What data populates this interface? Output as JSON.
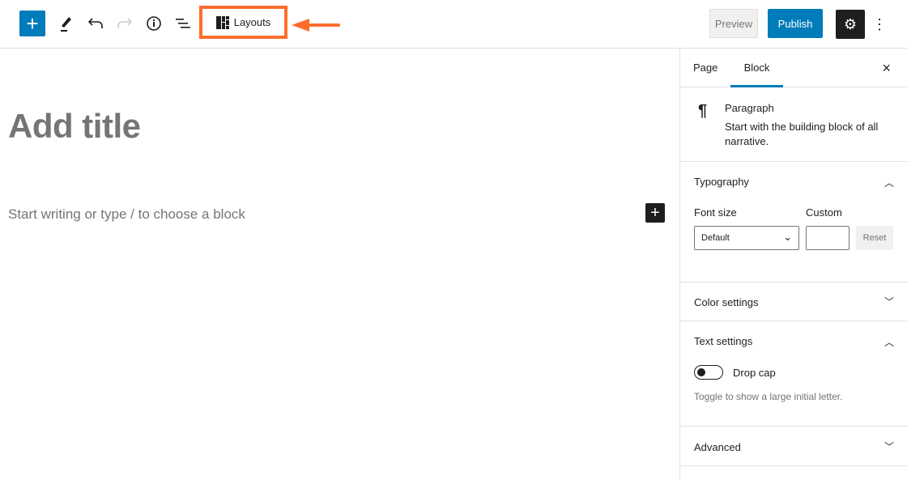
{
  "toolbar": {
    "add_label": "+",
    "layouts_label": "Layouts",
    "preview_label": "Preview",
    "publish_label": "Publish",
    "settings_icon": "gear-icon",
    "more_icon": "more-vertical-icon"
  },
  "editor": {
    "title_placeholder": "Add title",
    "block_placeholder": "Start writing or type / to choose a block"
  },
  "sidebar": {
    "tabs": [
      {
        "label": "Page"
      },
      {
        "label": "Block"
      }
    ],
    "close": "×",
    "block": {
      "name": "Paragraph",
      "description": "Start with the building block of all narrative."
    },
    "typography": {
      "title": "Typography",
      "font_size_label": "Font size",
      "custom_label": "Custom",
      "font_size_value": "Default",
      "custom_value": "",
      "reset_label": "Reset"
    },
    "color_settings": {
      "title": "Color settings"
    },
    "text_settings": {
      "title": "Text settings",
      "drop_cap_label": "Drop cap",
      "drop_cap_help": "Toggle to show a large initial letter.",
      "drop_cap_enabled": false
    },
    "advanced": {
      "title": "Advanced"
    }
  },
  "colors": {
    "accent": "#007cba",
    "highlight": "#ff6d2c"
  }
}
